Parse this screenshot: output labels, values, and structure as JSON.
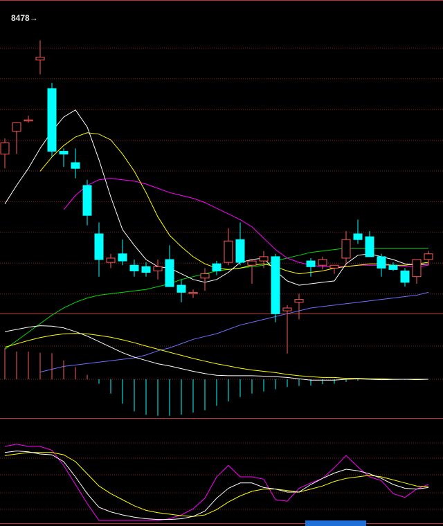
{
  "chart_data": {
    "type": "candlestick",
    "high_label": "8478→",
    "colors": {
      "up": "#ff5a5a",
      "down": "#00ffff",
      "ma5": "#ffffff",
      "ma10": "#ffff00",
      "ma20": "#ff00ff",
      "ma60": "#00dd00",
      "ma120": "#6f6fff",
      "grid": "#8a1f1f",
      "divider": "#c83232"
    },
    "price": {
      "ylim": [
        6600,
        8640
      ],
      "candles": [
        {
          "o": 7680,
          "h": 7790,
          "l": 7580,
          "c": 7760
        },
        {
          "o": 7840,
          "h": 7900,
          "l": 7680,
          "c": 7900
        },
        {
          "o": 7920,
          "h": 7950,
          "l": 7900,
          "c": 7920
        },
        {
          "o": 8340,
          "h": 8478,
          "l": 8240,
          "c": 8360
        },
        {
          "o": 8140,
          "h": 8180,
          "l": 7660,
          "c": 7700
        },
        {
          "o": 7700,
          "h": 7720,
          "l": 7590,
          "c": 7680
        },
        {
          "o": 7620,
          "h": 7720,
          "l": 7510,
          "c": 7580
        },
        {
          "o": 7460,
          "h": 7500,
          "l": 7180,
          "c": 7250
        },
        {
          "o": 7120,
          "h": 7200,
          "l": 6820,
          "c": 6940
        },
        {
          "o": 6920,
          "h": 6980,
          "l": 6880,
          "c": 6950
        },
        {
          "o": 6980,
          "h": 7080,
          "l": 6900,
          "c": 6930
        },
        {
          "o": 6900,
          "h": 6940,
          "l": 6820,
          "c": 6860
        },
        {
          "o": 6890,
          "h": 6920,
          "l": 6820,
          "c": 6850
        },
        {
          "o": 6860,
          "h": 6940,
          "l": 6800,
          "c": 6890
        },
        {
          "o": 6940,
          "h": 7040,
          "l": 6750,
          "c": 6750
        },
        {
          "o": 6760,
          "h": 6800,
          "l": 6640,
          "c": 6710
        },
        {
          "o": 6700,
          "h": 6730,
          "l": 6670,
          "c": 6710
        },
        {
          "o": 6810,
          "h": 6880,
          "l": 6720,
          "c": 6840
        },
        {
          "o": 6910,
          "h": 6930,
          "l": 6830,
          "c": 6860
        },
        {
          "o": 6920,
          "h": 7160,
          "l": 6900,
          "c": 7070
        },
        {
          "o": 7080,
          "h": 7200,
          "l": 6900,
          "c": 6920
        },
        {
          "o": 6900,
          "h": 6940,
          "l": 6770,
          "c": 6930
        },
        {
          "o": 6930,
          "h": 7000,
          "l": 6880,
          "c": 6960
        },
        {
          "o": 6960,
          "h": 6980,
          "l": 6500,
          "c": 6560
        },
        {
          "o": 6580,
          "h": 6620,
          "l": 6280,
          "c": 6600
        },
        {
          "o": 6640,
          "h": 6700,
          "l": 6520,
          "c": 6660
        },
        {
          "o": 6930,
          "h": 6950,
          "l": 6820,
          "c": 6890
        },
        {
          "o": 6900,
          "h": 6960,
          "l": 6870,
          "c": 6940
        },
        {
          "o": 6880,
          "h": 6900,
          "l": 6840,
          "c": 6900
        },
        {
          "o": 6950,
          "h": 7140,
          "l": 6900,
          "c": 7080
        },
        {
          "o": 7120,
          "h": 7220,
          "l": 7050,
          "c": 7080
        },
        {
          "o": 7100,
          "h": 7140,
          "l": 7000,
          "c": 6960
        },
        {
          "o": 6960,
          "h": 6980,
          "l": 6820,
          "c": 6880
        },
        {
          "o": 6900,
          "h": 6920,
          "l": 6860,
          "c": 6870
        },
        {
          "o": 6860,
          "h": 6880,
          "l": 6750,
          "c": 6780
        },
        {
          "o": 6820,
          "h": 6940,
          "l": 6770,
          "c": 6940
        },
        {
          "o": 6940,
          "h": 7000,
          "l": 6900,
          "c": 6980
        }
      ],
      "ma5": [
        7330,
        7460,
        7580,
        7720,
        7840,
        7940,
        7990,
        7870,
        7640,
        7380,
        7150,
        7040,
        6940,
        6890,
        6880,
        6840,
        6800,
        6780,
        6800,
        6850,
        6920,
        6940,
        6950,
        6860,
        6790,
        6760,
        6770,
        6780,
        6790,
        6910,
        6970,
        6980,
        6960,
        6940,
        6910,
        6900,
        6910
      ],
      "ma10": [
        null,
        null,
        null,
        7560,
        7660,
        7740,
        7800,
        7830,
        7820,
        7780,
        7680,
        7560,
        7410,
        7240,
        7110,
        7030,
        6960,
        6910,
        6880,
        6870,
        6880,
        6900,
        6910,
        6890,
        6860,
        6840,
        6850,
        6860,
        6880,
        6890,
        6900,
        6910,
        6910,
        6900,
        6900,
        6910,
        6920
      ],
      "ma20": [
        null,
        null,
        null,
        null,
        null,
        7290,
        7390,
        7460,
        7500,
        7510,
        7500,
        7490,
        7470,
        7440,
        7410,
        7390,
        7370,
        7340,
        7300,
        7260,
        7220,
        7170,
        7090,
        7010,
        6950,
        6920,
        6900,
        6890,
        6890,
        6890,
        6900,
        6900,
        6900,
        6900,
        6890,
        6890,
        6900
      ],
      "ma60": [
        6310,
        6370,
        6430,
        6490,
        6550,
        6600,
        6640,
        6670,
        6690,
        6700,
        6710,
        6720,
        6730,
        6750,
        6770,
        6800,
        6820,
        6840,
        6860,
        6870,
        6880,
        6890,
        6900,
        6930,
        6950,
        6970,
        6990,
        7000,
        7010,
        7020,
        7020,
        7020,
        7020,
        7020,
        7020,
        7020,
        7020
      ],
      "ma120": [
        null,
        null,
        null,
        6150,
        6170,
        6190,
        6200,
        6210,
        6220,
        6230,
        6240,
        6250,
        6270,
        6300,
        6320,
        6350,
        6380,
        6400,
        6420,
        6450,
        6480,
        6500,
        6520,
        6540,
        6560,
        6580,
        6600,
        6610,
        6620,
        6630,
        6640,
        6650,
        6660,
        6670,
        6680,
        6690,
        6710
      ]
    },
    "macd": {
      "dif": [
        215,
        225,
        235,
        242,
        240,
        232,
        215,
        195,
        170,
        145,
        120,
        100,
        85,
        70,
        60,
        48,
        36,
        26,
        18,
        16,
        16,
        16,
        14,
        12,
        8,
        2,
        -4,
        -4,
        -4,
        0,
        2,
        0,
        -2,
        -1,
        0,
        0,
        0
      ],
      "dea": [
        145,
        160,
        175,
        188,
        198,
        205,
        207,
        205,
        198,
        190,
        178,
        165,
        150,
        136,
        122,
        108,
        94,
        82,
        70,
        60,
        50,
        42,
        36,
        30,
        22,
        16,
        12,
        8,
        8,
        4,
        4,
        2,
        2,
        0,
        0,
        -2,
        0
      ],
      "hist": [
        140,
        125,
        125,
        120,
        118,
        85,
        55,
        20,
        -20,
        -65,
        -110,
        -145,
        -160,
        -165,
        -165,
        -160,
        -150,
        -140,
        -120,
        -100,
        -80,
        -65,
        -55,
        -45,
        -35,
        -30,
        -28,
        -22,
        -20,
        -12,
        -6,
        0,
        0,
        0,
        -3,
        -2,
        0
      ]
    },
    "kdj": {
      "k": [
        92,
        94,
        93,
        90,
        89,
        80,
        60,
        38,
        20,
        14,
        10,
        7,
        5,
        4,
        4,
        5,
        8,
        15,
        32,
        45,
        52,
        52,
        46,
        44,
        40,
        40,
        50,
        58,
        65,
        70,
        68,
        64,
        58,
        50,
        45,
        44,
        46
      ],
      "d": [
        88,
        90,
        92,
        92,
        92,
        89,
        80,
        64,
        48,
        38,
        30,
        22,
        16,
        13,
        11,
        9,
        8,
        10,
        17,
        27,
        35,
        41,
        44,
        44,
        42,
        40,
        44,
        48,
        54,
        58,
        60,
        62,
        60,
        56,
        52,
        48,
        47
      ],
      "j": [
        100,
        103,
        100,
        100,
        95,
        75,
        50,
        25,
        0,
        -5,
        -3,
        -2,
        -2,
        -1,
        5,
        10,
        18,
        32,
        60,
        75,
        60,
        60,
        57,
        30,
        28,
        45,
        52,
        58,
        72,
        88,
        73,
        60,
        55,
        38,
        33,
        44,
        50
      ]
    }
  }
}
